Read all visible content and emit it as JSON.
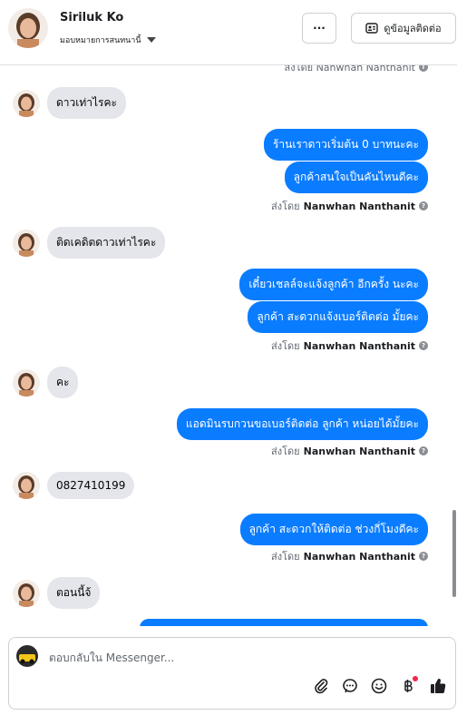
{
  "header": {
    "name": "Siriluk Ko",
    "assign_label": "มอบหมายการสนทนานี้",
    "more_label": "···",
    "contact_label": "ดูข้อมูลติดต่อ"
  },
  "thread": {
    "top_sender": "ส่งโดย Nanwhan Nanthanit",
    "sender_prefix": "ส่งโดย",
    "sender_name": "Nanwhan Nanthanit",
    "messages": [
      {
        "text": "ดาวเท่าไรคะ"
      },
      {
        "text": "ร้านเราดาวเริ่มต้น 0 บาทนะคะ"
      },
      {
        "text": "ลูกค้าสนใจเป็นคันไหนดีคะ"
      },
      {
        "text": "ติดเคดิตดาวเท่าไรคะ"
      },
      {
        "text": "เดี๋ยวเชลล์จะแจ้งลูกค้า  อีกครั้ง นะคะ"
      },
      {
        "text": "ลูกค้า สะดวกแจ้งเบอร์ติดต่อ มั้ยคะ"
      },
      {
        "text": "คะ"
      },
      {
        "text": "แอดมินรบกวนขอเบอร์ติดต่อ ลูกค้า หน่อยได้มั้ยคะ"
      },
      {
        "text": "0827410199"
      },
      {
        "text": "ลูกค้า สะดวกให้ติดต่อ ช่วงกี่โมงดีคะ"
      },
      {
        "text": "ตอนนี้จ้"
      }
    ]
  },
  "composer": {
    "placeholder": "ตอบกลับใน Messenger..."
  },
  "icons": {
    "attach": "paperclip-icon",
    "saved_reply": "chat-bubble-icon",
    "emoji": "smiley-icon",
    "payment": "baht-icon",
    "like": "thumbs-up-icon"
  },
  "colors": {
    "outgoing": "#0a7cff",
    "incoming": "#e4e6eb",
    "like": "#0a7cff",
    "notification": "#f02849"
  }
}
